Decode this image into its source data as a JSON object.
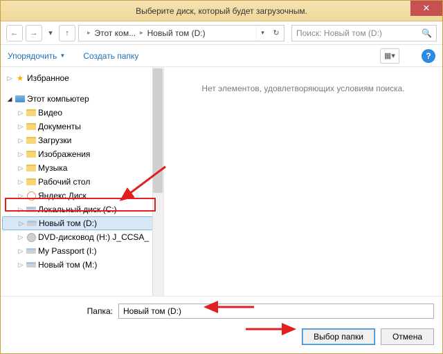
{
  "title": "Выберите диск, который будет загрузочным.",
  "breadcrumb": {
    "root": "Этот ком...",
    "current": "Новый том (D:)"
  },
  "search": {
    "placeholder": "Поиск: Новый том (D:)"
  },
  "toolbar": {
    "organize": "Упорядочить",
    "new_folder": "Создать папку"
  },
  "tree": {
    "favorites": "Избранное",
    "this_pc": "Этот компьютер",
    "items": [
      {
        "label": "Видео"
      },
      {
        "label": "Документы"
      },
      {
        "label": "Загрузки"
      },
      {
        "label": "Изображения"
      },
      {
        "label": "Музыка"
      },
      {
        "label": "Рабочий стол"
      },
      {
        "label": "Яндекс.Диск"
      },
      {
        "label": "Локальный диск (C:)"
      },
      {
        "label": "Новый том (D:)"
      },
      {
        "label": "DVD-дисковод (H:) J_CCSA_"
      },
      {
        "label": "My Passport (I:)"
      },
      {
        "label": "Новый том (M:)"
      }
    ]
  },
  "main": {
    "empty": "Нет элементов, удовлетворяющих условиям поиска."
  },
  "footer": {
    "folder_label": "Папка:",
    "folder_value": "Новый том (D:)",
    "select": "Выбор папки",
    "cancel": "Отмена"
  }
}
